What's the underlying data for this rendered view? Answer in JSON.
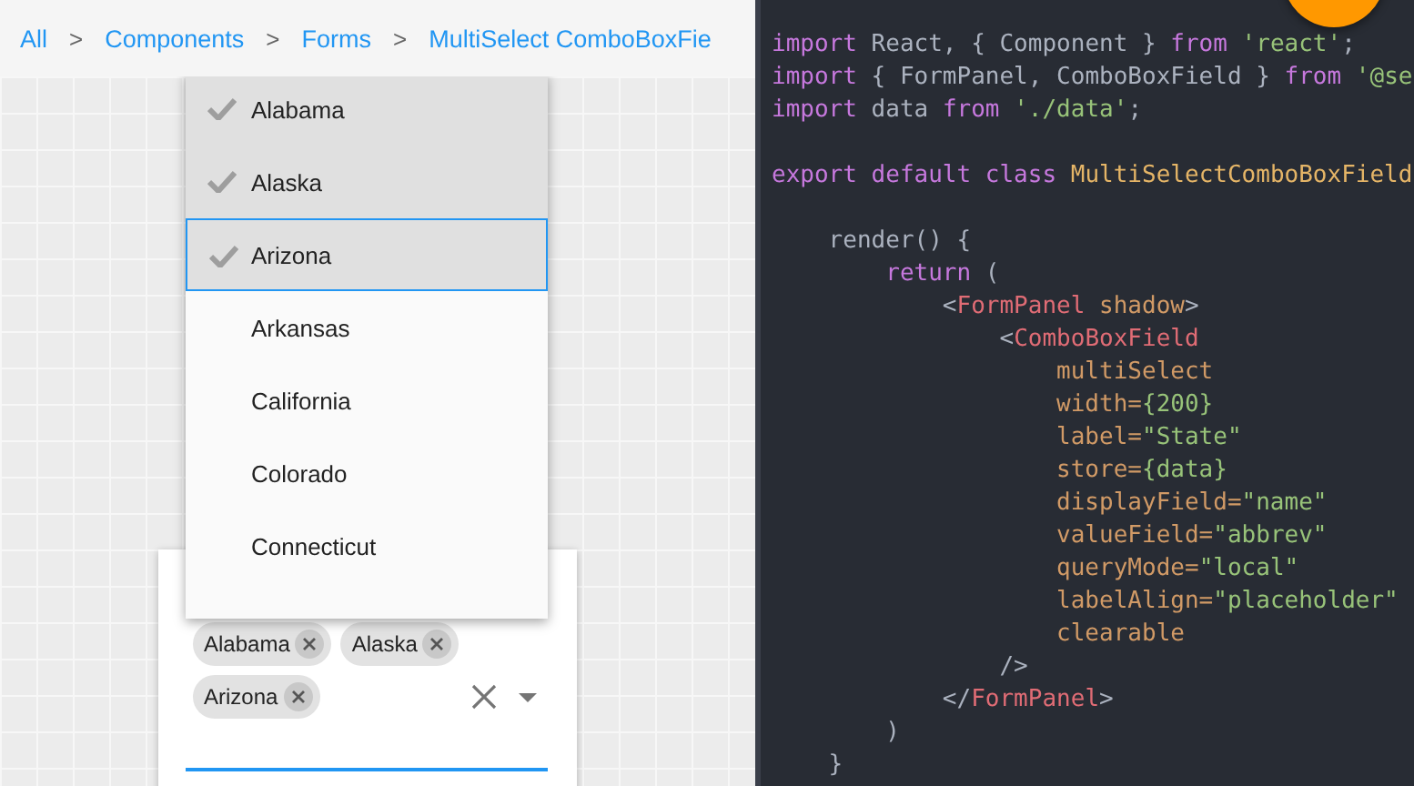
{
  "breadcrumb": [
    {
      "label": "All"
    },
    {
      "label": "Components"
    },
    {
      "label": "Forms"
    },
    {
      "label": "MultiSelect ComboBoxFie"
    }
  ],
  "breadcrumb_separator": ">",
  "dropdown": {
    "items": [
      {
        "label": "Alabama",
        "checked": true,
        "selected": false
      },
      {
        "label": "Alaska",
        "checked": true,
        "selected": false
      },
      {
        "label": "Arizona",
        "checked": true,
        "selected": true
      },
      {
        "label": "Arkansas",
        "checked": false,
        "selected": false
      },
      {
        "label": "California",
        "checked": false,
        "selected": false
      },
      {
        "label": "Colorado",
        "checked": false,
        "selected": false
      },
      {
        "label": "Connecticut",
        "checked": false,
        "selected": false
      }
    ]
  },
  "field": {
    "chips": [
      {
        "label": "Alabama"
      },
      {
        "label": "Alaska"
      },
      {
        "label": "Arizona"
      }
    ],
    "focused": true
  },
  "code": [
    {
      "kind": "code",
      "tokens": [
        {
          "kind": "keyword",
          "text": "import"
        },
        {
          "kind": "plain",
          "text": " React, { Component } "
        },
        {
          "kind": "keyword",
          "text": "from "
        },
        {
          "kind": "string",
          "text": "'react'"
        },
        {
          "kind": "plain",
          "text": ";"
        }
      ]
    },
    {
      "kind": "code",
      "tokens": [
        {
          "kind": "keyword",
          "text": "import"
        },
        {
          "kind": "plain",
          "text": " { FormPanel, ComboBoxField } "
        },
        {
          "kind": "keyword",
          "text": "from "
        },
        {
          "kind": "string",
          "text": "'@se"
        }
      ]
    },
    {
      "kind": "code",
      "tokens": [
        {
          "kind": "keyword",
          "text": "import"
        },
        {
          "kind": "plain",
          "text": " data "
        },
        {
          "kind": "keyword",
          "text": "from "
        },
        {
          "kind": "string",
          "text": "'./data'"
        },
        {
          "kind": "plain",
          "text": ";"
        }
      ]
    },
    {
      "kind": "blank"
    },
    {
      "kind": "code",
      "tokens": [
        {
          "kind": "keyword",
          "text": "export default class "
        },
        {
          "kind": "class",
          "text": "MultiSelectComboBoxField"
        }
      ]
    },
    {
      "kind": "blank"
    },
    {
      "kind": "code",
      "tokens": [
        {
          "kind": "plain",
          "text": "    render() {"
        }
      ]
    },
    {
      "kind": "code",
      "tokens": [
        {
          "kind": "keyword",
          "text": "        return"
        },
        {
          "kind": "plain",
          "text": " ("
        }
      ]
    },
    {
      "kind": "code",
      "tokens": [
        {
          "kind": "plain",
          "text": "            <"
        },
        {
          "kind": "tag",
          "text": "FormPanel"
        },
        {
          "kind": "attr",
          "text": " shadow"
        },
        {
          "kind": "plain",
          "text": ">"
        }
      ]
    },
    {
      "kind": "code",
      "tokens": [
        {
          "kind": "plain",
          "text": "                <"
        },
        {
          "kind": "tag",
          "text": "ComboBoxField"
        }
      ]
    },
    {
      "kind": "code",
      "tokens": [
        {
          "kind": "attr",
          "text": "                    multiSelect"
        }
      ]
    },
    {
      "kind": "code",
      "tokens": [
        {
          "kind": "attr",
          "text": "                    width="
        },
        {
          "kind": "string",
          "text": "{200}"
        }
      ]
    },
    {
      "kind": "code",
      "tokens": [
        {
          "kind": "attr",
          "text": "                    label="
        },
        {
          "kind": "string",
          "text": "\"State\""
        }
      ]
    },
    {
      "kind": "code",
      "tokens": [
        {
          "kind": "attr",
          "text": "                    store="
        },
        {
          "kind": "string",
          "text": "{data}"
        }
      ]
    },
    {
      "kind": "code",
      "tokens": [
        {
          "kind": "attr",
          "text": "                    displayField="
        },
        {
          "kind": "string",
          "text": "\"name\""
        }
      ]
    },
    {
      "kind": "code",
      "tokens": [
        {
          "kind": "attr",
          "text": "                    valueField="
        },
        {
          "kind": "string",
          "text": "\"abbrev\""
        }
      ]
    },
    {
      "kind": "code",
      "tokens": [
        {
          "kind": "attr",
          "text": "                    queryMode="
        },
        {
          "kind": "string",
          "text": "\"local\""
        }
      ]
    },
    {
      "kind": "code",
      "tokens": [
        {
          "kind": "attr",
          "text": "                    labelAlign="
        },
        {
          "kind": "string",
          "text": "\"placeholder\""
        }
      ]
    },
    {
      "kind": "code",
      "tokens": [
        {
          "kind": "attr",
          "text": "                    clearable"
        }
      ]
    },
    {
      "kind": "code",
      "tokens": [
        {
          "kind": "plain",
          "text": "                />"
        }
      ]
    },
    {
      "kind": "code",
      "tokens": [
        {
          "kind": "plain",
          "text": "            </"
        },
        {
          "kind": "tag",
          "text": "FormPanel"
        },
        {
          "kind": "plain",
          "text": ">"
        }
      ]
    },
    {
      "kind": "code",
      "tokens": [
        {
          "kind": "plain",
          "text": "        )"
        }
      ]
    },
    {
      "kind": "code",
      "tokens": [
        {
          "kind": "plain",
          "text": "    }"
        }
      ]
    }
  ]
}
